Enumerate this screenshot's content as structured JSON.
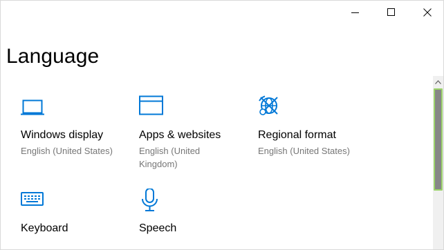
{
  "window": {
    "controls": {
      "minimize_icon": "minimize-icon",
      "maximize_icon": "maximize-icon",
      "close_icon": "close-icon"
    }
  },
  "page": {
    "title": "Language"
  },
  "tiles": [
    {
      "icon": "laptop-icon",
      "title": "Windows display",
      "subtitle": "English (United States)"
    },
    {
      "icon": "browser-window-icon",
      "title": "Apps & websites",
      "subtitle": "English (United Kingdom)"
    },
    {
      "icon": "globe-clock-icon",
      "title": "Regional format",
      "subtitle": "English (United States)"
    },
    {
      "icon": "keyboard-icon",
      "title": "Keyboard",
      "subtitle": ""
    },
    {
      "icon": "microphone-icon",
      "title": "Speech",
      "subtitle": ""
    }
  ],
  "colors": {
    "accent": "#0078d7",
    "subtitle": "#767676",
    "scroll_thumb": "#878787",
    "scroll_thumb_border": "#9bd36a"
  }
}
